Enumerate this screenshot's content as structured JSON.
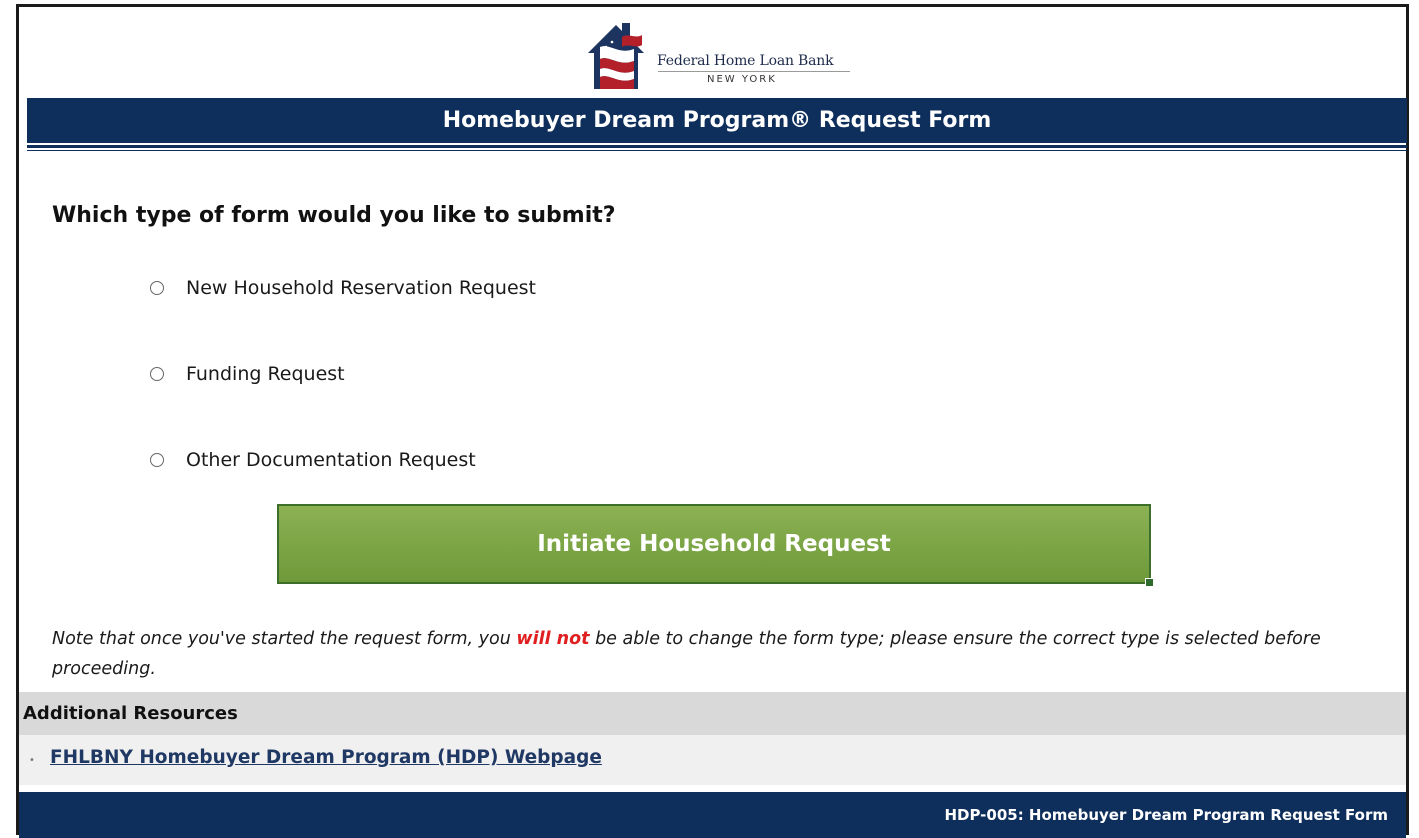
{
  "header": {
    "logo": {
      "name_line1": "Federal Home Loan Bank",
      "name_line2": "NEW YORK",
      "icon": "house-flag-logo"
    },
    "title": "Homebuyer Dream Program® Request Form"
  },
  "form": {
    "question": "Which type of form would you like to submit?",
    "options": [
      {
        "label": "New Household Reservation Request",
        "selected": false
      },
      {
        "label": "Funding Request",
        "selected": false
      },
      {
        "label": "Other Documentation Request",
        "selected": false
      }
    ],
    "submit_label": "Initiate Household Request"
  },
  "note": {
    "before": "Note that once you've started the request form, you ",
    "emphasis": "will not",
    "after": " be able to change the form type; please ensure the correct type is selected before proceeding."
  },
  "resources": {
    "header": "Additional Resources",
    "links": [
      {
        "label": "FHLBNY Homebuyer Dream Program (HDP) Webpage"
      }
    ]
  },
  "footer": {
    "text": "HDP-005: Homebuyer Dream Program Request Form"
  },
  "colors": {
    "navy": "#0e2f5c",
    "button_green": "#7ba546",
    "emphasis_red": "#e02020",
    "link": "#1f3864"
  }
}
